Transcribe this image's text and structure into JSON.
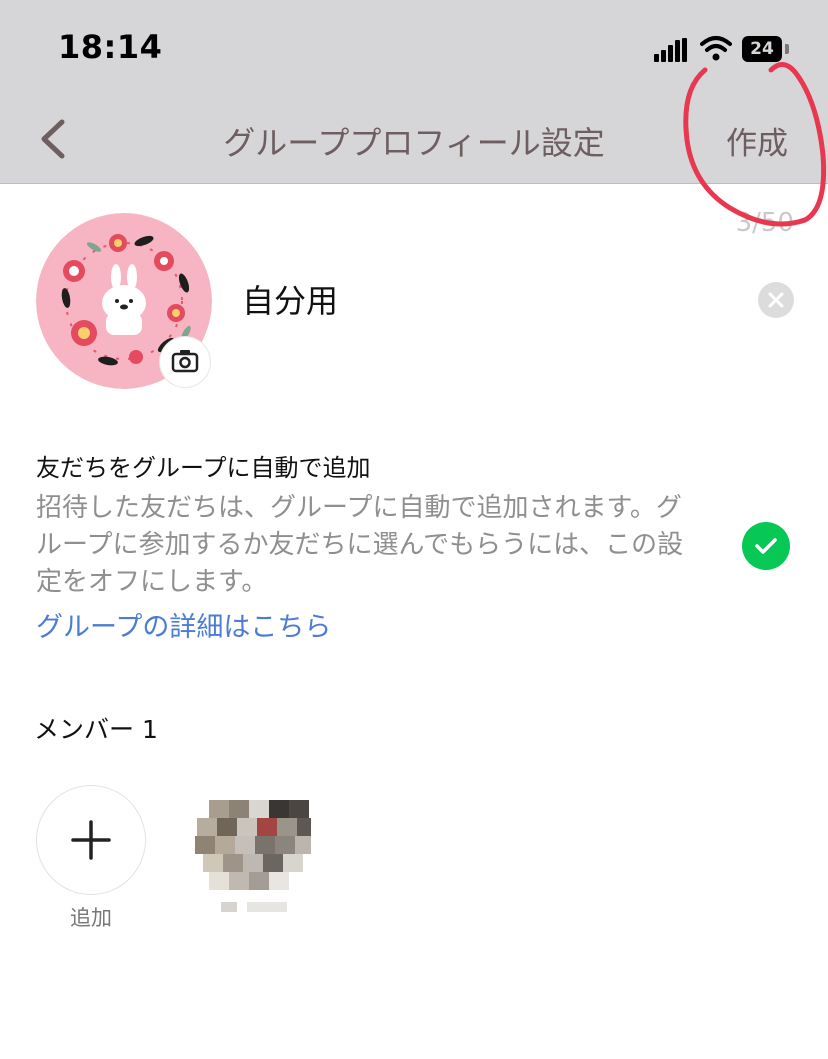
{
  "status_bar": {
    "time": "18:14",
    "battery": "24"
  },
  "nav": {
    "title": "グループプロフィール設定",
    "create_label": "作成"
  },
  "profile": {
    "char_count": "3/50",
    "group_name": "自分用"
  },
  "auto_add": {
    "title": "友だちをグループに自動で追加",
    "description": "招待した友だちは、グループに自動で追加されます。グループに参加するか友だちに選んでもらうには、この設定をオフにします。",
    "link": "グループの詳細はこちら",
    "enabled": true
  },
  "members": {
    "label": "メンバー 1",
    "add_label": "追加"
  },
  "colors": {
    "accent_green": "#07c755",
    "link_blue": "#4c7cd4",
    "annotation_red": "#e8384f"
  }
}
